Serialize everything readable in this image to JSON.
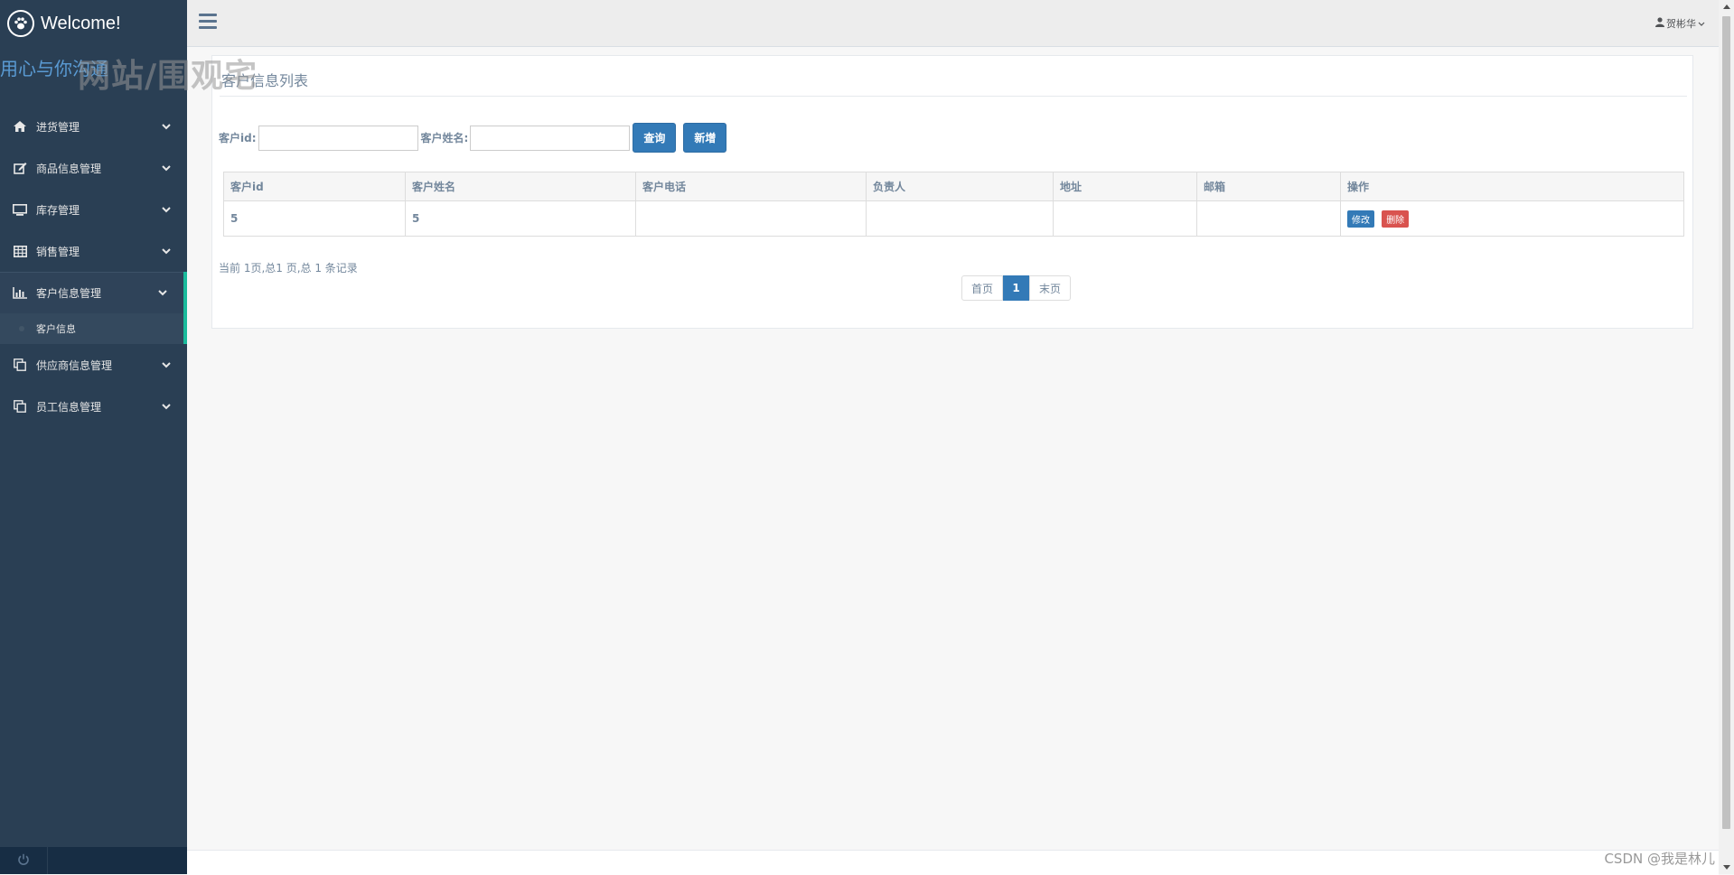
{
  "brand": {
    "title": "Welcome!"
  },
  "sidebar": {
    "subtitle": "用心与你沟通",
    "watermark": "网站/围观宅",
    "items": [
      {
        "label": "进货管理",
        "icon": "home-icon"
      },
      {
        "label": "商品信息管理",
        "icon": "edit-icon"
      },
      {
        "label": "库存管理",
        "icon": "desktop-icon"
      },
      {
        "label": "销售管理",
        "icon": "table-icon"
      },
      {
        "label": "客户信息管理",
        "icon": "bar-chart-icon",
        "active": true
      },
      {
        "label": "供应商信息管理",
        "icon": "clone-icon"
      },
      {
        "label": "员工信息管理",
        "icon": "clone-icon"
      }
    ],
    "subitem": {
      "label": "客户信息"
    }
  },
  "topnav": {
    "user": "贺彬华"
  },
  "panel": {
    "title": "客户信息列表",
    "search": {
      "id_label": "客户id:",
      "id_value": "",
      "name_label": "客户姓名:",
      "name_value": "",
      "query_button": "查询",
      "add_button": "新增"
    },
    "table": {
      "headers": [
        "客户id",
        "客户姓名",
        "客户电话",
        "负责人",
        "地址",
        "邮箱",
        "操作"
      ],
      "rows": [
        {
          "id": "5",
          "name": "5",
          "phone": "",
          "manager": "",
          "address": "",
          "email": ""
        }
      ],
      "edit_label": "修改",
      "delete_label": "删除"
    },
    "pager": {
      "info": "当前 1页,总1 页,总 1 条记录",
      "first": "首页",
      "current": "1",
      "last": "末页"
    }
  },
  "footer": {
    "watermark": "CSDN @我是林儿"
  },
  "colors": {
    "sidebar_bg": "#2a3f54",
    "accent": "#1abb9c",
    "primary": "#337ab7",
    "danger": "#d9534f",
    "text": "#73879c"
  }
}
